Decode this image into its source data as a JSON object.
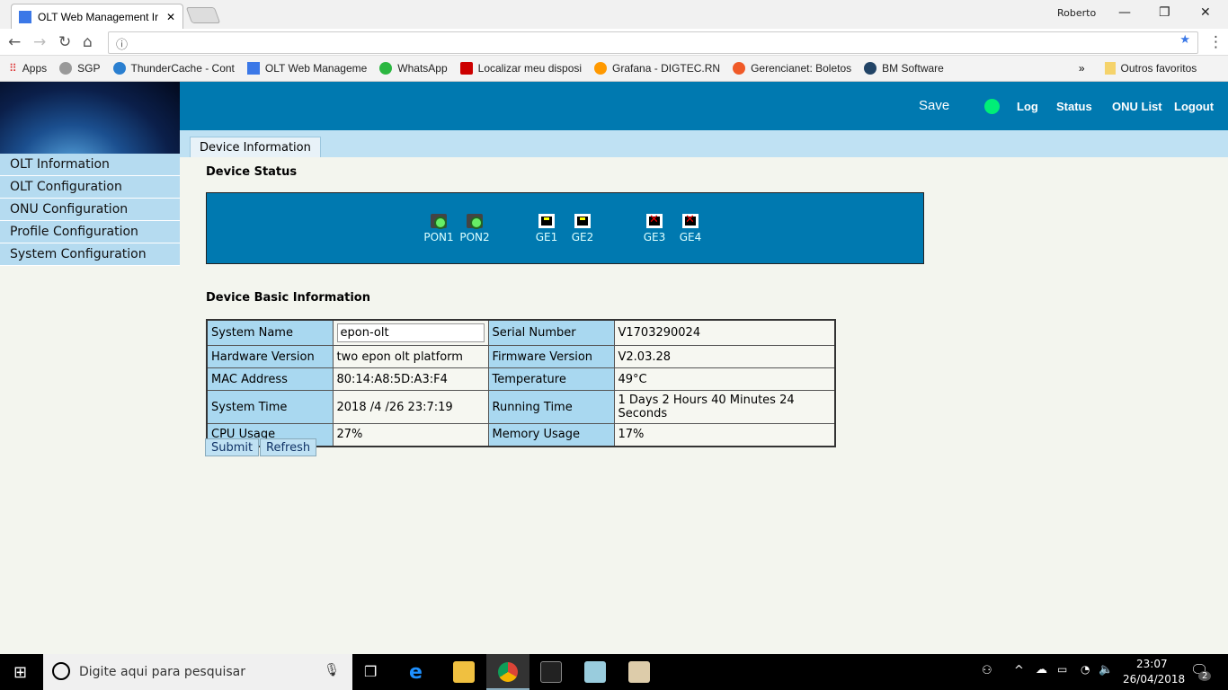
{
  "browser": {
    "tab_title": "OLT Web Management Ir",
    "user": "Roberto",
    "address": "",
    "bookmarks": [
      "Apps",
      "SGP",
      "ThunderCache - Cont",
      "OLT Web Manageme",
      "WhatsApp",
      "Localizar meu disposi",
      "Grafana - DIGTEC.RN",
      "Gerencianet: Boletos",
      "BM Software"
    ],
    "more": "»",
    "other_bookmarks": "Outros favoritos"
  },
  "header": {
    "save": "Save",
    "log": "Log",
    "status": "Status",
    "onu_list": "ONU List",
    "logout": "Logout",
    "status_color": "#00ee77"
  },
  "subtab": "Device Information",
  "sidebar": [
    "OLT Information",
    "OLT Configuration",
    "ONU Configuration",
    "Profile Configuration",
    "System Configuration"
  ],
  "device_status": {
    "title": "Device Status",
    "ports": [
      {
        "name": "PON1",
        "state": "up"
      },
      {
        "name": "PON2",
        "state": "up"
      },
      {
        "name": "GE1",
        "state": "up"
      },
      {
        "name": "GE2",
        "state": "up"
      },
      {
        "name": "GE3",
        "state": "down"
      },
      {
        "name": "GE4",
        "state": "down"
      }
    ]
  },
  "basic": {
    "title": "Device Basic Information",
    "rows": [
      [
        "System Name",
        "epon-olt",
        "Serial Number",
        "V1703290024"
      ],
      [
        "Hardware Version",
        "two epon olt platform",
        "Firmware Version",
        "V2.03.28"
      ],
      [
        "MAC Address",
        "80:14:A8:5D:A3:F4",
        "Temperature",
        "49°C"
      ],
      [
        "System Time",
        "2018 /4 /26 23:7:19",
        "Running Time",
        "1 Days 2 Hours 40 Minutes 24 Seconds"
      ],
      [
        "CPU Usage",
        "27%",
        "Memory Usage",
        "17%"
      ]
    ],
    "submit": "Submit",
    "refresh": "Refresh"
  },
  "taskbar": {
    "search_placeholder": "Digite aqui para pesquisar",
    "time": "23:07",
    "date": "26/04/2018",
    "notifications": "2"
  }
}
